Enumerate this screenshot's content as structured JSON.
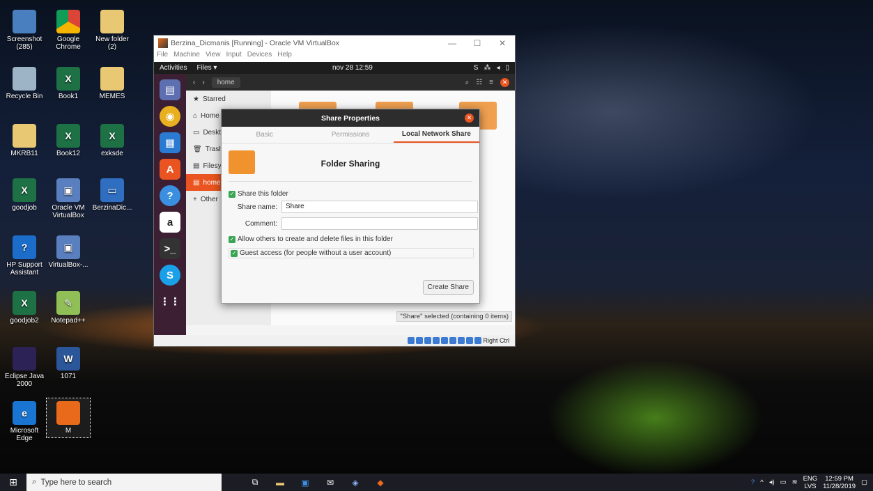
{
  "desktop": {
    "icons": [
      {
        "label": "Screenshot (285)",
        "icon": "screenshot-icon"
      },
      {
        "label": "Google Chrome",
        "icon": "chrome-icon"
      },
      {
        "label": "New folder (2)",
        "icon": "folder-icon"
      },
      {
        "label": "Recycle Bin",
        "icon": "recycle-bin-icon"
      },
      {
        "label": "Book1",
        "icon": "excel-icon"
      },
      {
        "label": "MEMES",
        "icon": "folder-icon"
      },
      {
        "label": "MKRB11",
        "icon": "file-icon"
      },
      {
        "label": "Book12",
        "icon": "excel-icon"
      },
      {
        "label": "exksde",
        "icon": "excel-icon"
      },
      {
        "label": "goodjob",
        "icon": "excel-icon"
      },
      {
        "label": "Oracle VM VirtualBox",
        "icon": "virtualbox-icon"
      },
      {
        "label": "BerzinaDic...",
        "icon": "vm-shortcut-icon"
      },
      {
        "label": "HP Support Assistant",
        "icon": "help-icon"
      },
      {
        "label": "VirtualBox-...",
        "icon": "virtualbox-icon"
      },
      {
        "label": "goodjob2",
        "icon": "excel-icon"
      },
      {
        "label": "Notepad++",
        "icon": "notepad-icon"
      },
      {
        "label": "Eclipse Java 2000",
        "icon": "eclipse-icon"
      },
      {
        "label": "1071",
        "icon": "word-icon"
      },
      {
        "label": "Microsoft Edge",
        "icon": "edge-icon"
      },
      {
        "label": "M",
        "icon": "vm-icon"
      }
    ]
  },
  "vbox": {
    "title": "Berzina_Dicmanis [Running] - Oracle VM VirtualBox",
    "menu": [
      "File",
      "Machine",
      "View",
      "Input",
      "Devices",
      "Help"
    ],
    "min": "—",
    "max": "☐",
    "close": "✕",
    "host_key": "Right Ctrl"
  },
  "guest": {
    "activities": "Activities",
    "files_menu": "Files ▾",
    "clock": "nov 28  12:59",
    "path": "home",
    "sidebar": [
      "Starred",
      "Home",
      "Deskt",
      "Trash",
      "Filesy",
      "home",
      "Other"
    ],
    "status": "\"Share\" selected  (containing 0 items)"
  },
  "dialog": {
    "title": "Share Properties",
    "tabs": [
      "Basic",
      "Permissions",
      "Local Network Share"
    ],
    "heading": "Folder Sharing",
    "share_this_folder": "Share this folder",
    "share_name_label": "Share name:",
    "share_name_value": "Share",
    "comment_label": "Comment:",
    "comment_value": "",
    "allow_others": "Allow others to create and delete files in this folder",
    "guest_access": "Guest access (for people without a user account)",
    "create_button": "Create Share"
  },
  "taskbar": {
    "search_placeholder": "Type here to search",
    "lang_top": "ENG",
    "lang_bottom": "LVS",
    "time": "12:59 PM",
    "date": "11/28/2019"
  }
}
